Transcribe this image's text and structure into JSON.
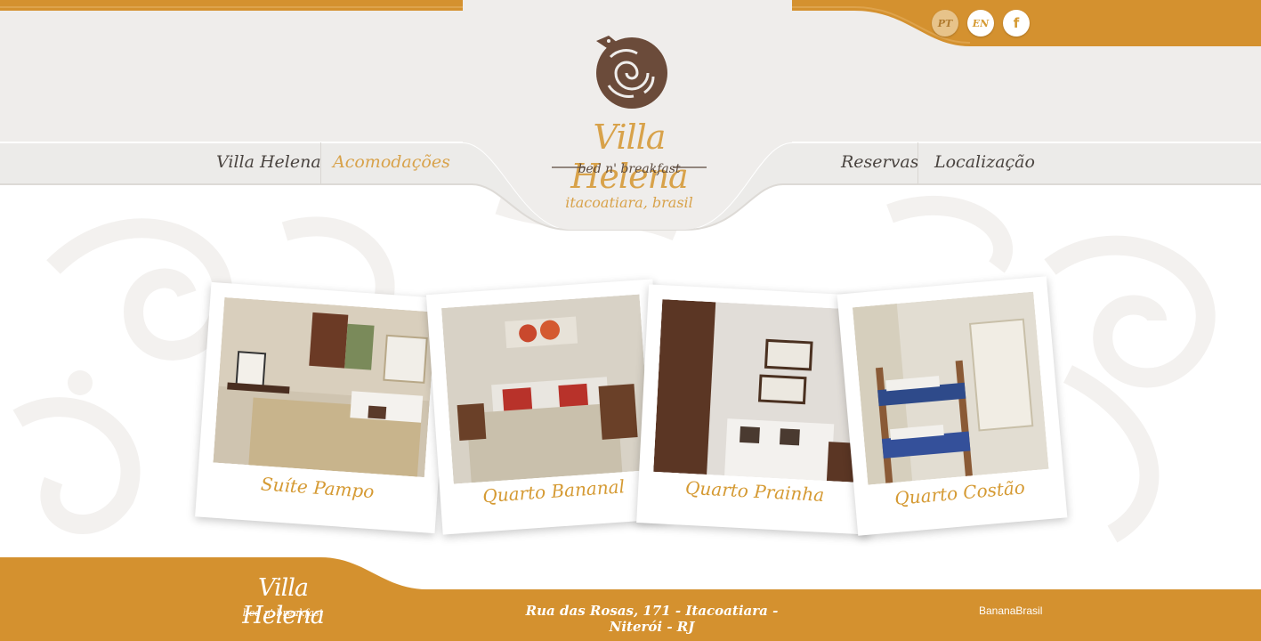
{
  "colors": {
    "accent": "#d59a33",
    "accent_light": "#d8a24a",
    "header_bg": "#efedeb",
    "footer_bg": "#d4912f",
    "text_dark": "#4a4440"
  },
  "languages": {
    "pt": "PT",
    "en": "EN",
    "facebook_icon": "f"
  },
  "nav": {
    "left": [
      {
        "label": "Villa Helena"
      },
      {
        "label": "Acomodações"
      }
    ],
    "right": [
      {
        "label": "Reservas"
      },
      {
        "label": "Localização"
      }
    ],
    "active": "Acomodações"
  },
  "logo": {
    "title": "Villa Helena",
    "tagline": "bed n' breakfast",
    "location": "itacoatiara, brasil"
  },
  "rooms": [
    {
      "name": "Suíte Pampo"
    },
    {
      "name": "Quarto Bananal"
    },
    {
      "name": "Quarto Prainha"
    },
    {
      "name": "Quarto Costão"
    }
  ],
  "footer": {
    "logo_title": "Villa Helena",
    "logo_tagline": "bed n' breakfast",
    "address": "Rua das Rosas, 171 - Itacoatiara - Niterói - RJ",
    "credit": "BananaBrasil"
  }
}
